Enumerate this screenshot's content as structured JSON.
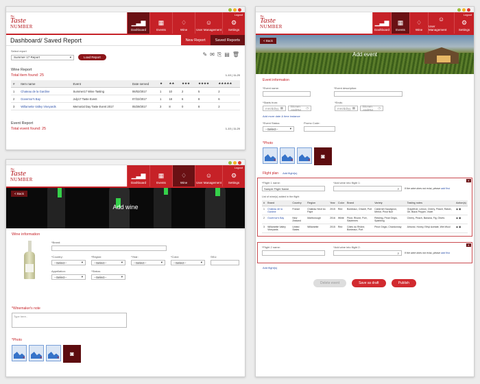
{
  "brand": {
    "top": "The",
    "middle": "Taste",
    "bottom": "NUMBER"
  },
  "nav": {
    "logout": "Logout",
    "dashboard": "Dashboard",
    "events": "Events",
    "wine": "Wine",
    "users": "User Management",
    "settings": "Settings"
  },
  "report": {
    "title": "Dashboard/ Saved Report",
    "new_report": "New Report",
    "saved_reports": "Saved Reports",
    "select_label": "Select report",
    "select_value": "Summer 17 Report",
    "load_button": "Load Report",
    "wine_report_title": "Wine Report",
    "wine_total": "Total item found: 25",
    "pagination1": "1-10 | 11-20",
    "columns": [
      "#",
      "Item name",
      "Event",
      "Date served",
      "★",
      "★★",
      "★★★",
      "★★★★",
      "★★★★★"
    ],
    "rows": [
      [
        "1",
        "Chateau de la Gardine",
        "Summer17 Wine Tasting",
        "06/02/2017",
        "1",
        "10",
        "2",
        "5",
        "2"
      ],
      [
        "2",
        "Governor's Bay",
        "July17 Taste Event",
        "07/22/2017",
        "1",
        "18",
        "6",
        "8",
        "6"
      ],
      [
        "3",
        "Willamette Valley Vineyards",
        "Memorial Day Taste Event 2017",
        "05/29/2017",
        "3",
        "8",
        "0",
        "8",
        "2"
      ]
    ],
    "event_report_title": "Event Report",
    "event_total": "Total event found: 25",
    "pagination2": "1-10 | 11-20"
  },
  "wine": {
    "back": "< Back",
    "banner": "Add wine",
    "section": "Wine information",
    "brand_label": "*Brand:",
    "country_label": "*Country:",
    "region_label": "*Region:",
    "year_label": "*Year:",
    "color_label": "*Color:",
    "sku_label": "SKU:",
    "appellation_label": "Appellation:",
    "status_label": "*Status:",
    "select_placeholder": "--Select--",
    "note_label": "*Winemaker's note",
    "note_placeholder": "Type here..",
    "photo_label": "*Photo"
  },
  "event": {
    "back": "< Back",
    "banner": "Add event",
    "section": "Event information",
    "name_label": "*Event name:",
    "desc_label": "*Event description:",
    "starts_label": "*Starts from:",
    "ends_label": "*Ends:",
    "date_ph": "mm/dd/yy",
    "time_ph": "hh:mm AM/PM",
    "add_date": "Add more date & time instance",
    "status_label": "*Event Status:",
    "promo_label": "Promo Code:",
    "select_placeholder": "--Select--",
    "photo_label": "*Photo",
    "flight_plan": "Flight plan",
    "add_flight": "Add flight(s)",
    "flight1_label": "*Flight 1 name:",
    "flight1_value": "Sample Flight Name",
    "add_wine1": "*Add wine into flight 1:",
    "not_exist": "If the wine does not exist, please",
    "add_link": "add first",
    "list_label": "List of wine(s) added in the flight",
    "fcols": [
      "#",
      "Brand",
      "Country",
      "Region",
      "Year",
      "Color",
      "Brand",
      "Variety",
      "Tasting notes",
      "Action(s)"
    ],
    "frows": [
      [
        "1",
        "Chateau de la Gardine",
        "France",
        "Chateau Neuf du Pape",
        "2015",
        "Red",
        "Bordeaux, Chianti, Port",
        "Cabernet Sauvignon, Merlot, Pinot Noir",
        "Grapefruit, Lemon, Cherry, Peach, Raisin, Gif, Black Pepper, Violet"
      ],
      [
        "2",
        "Governor's Bay",
        "New Zealand",
        "Marlborough",
        "2016",
        "White",
        "Pinot, Rhone, Port, Sauternes",
        "Riesling, Pinot Grigio, Sparkling",
        "Cherry, Peach, Banana, Fig, Olives"
      ],
      [
        "3",
        "Willamette Valley Vineyards",
        "United States",
        "Willamette",
        "2015",
        "Red",
        "Côtes du Rhône, Bordeaux, Port",
        "Pinot Grigio, Chardonnay",
        "Almond, Honey, Ethyl Acetate, Wet Wool"
      ]
    ],
    "flight2_label": "*Flight 2 name:",
    "add_wine2": "*Add wine into flight 2:",
    "add_flight2": "Add flight(s)",
    "delete": "Delete event",
    "save_draft": "Save as draft",
    "publish": "Publish"
  }
}
